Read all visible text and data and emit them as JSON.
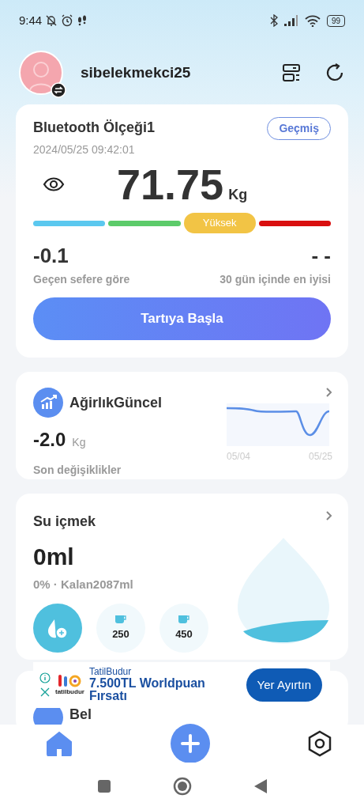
{
  "status_bar": {
    "time": "9:44",
    "battery": "99"
  },
  "profile": {
    "username": "sibelekmekci25"
  },
  "scale_card": {
    "title": "Bluetooth Ölçeği1",
    "history_button": "Geçmiş",
    "timestamp": "2024/05/25 09:42:01",
    "weight": "71.75",
    "unit": "Kg",
    "segments": [
      {
        "color": "#5bc8ef",
        "selected": false
      },
      {
        "color": "#5ccb6a",
        "selected": false
      },
      {
        "color": "#f2c445",
        "selected": true,
        "label": "Yüksek"
      },
      {
        "color": "#d90f0f",
        "selected": false
      }
    ],
    "change_value": "-0.1",
    "change_label": "Geçen sefere göre",
    "best_value": "- -",
    "best_label": "30 gün içinde en iyisi",
    "start_button": "Tartıya Başla"
  },
  "weight_card": {
    "title": "AğirlıkGüncel",
    "value": "-2.0",
    "unit": "Kg",
    "caption": "Son değişiklikler",
    "x_labels": [
      "05/04",
      "05/25"
    ]
  },
  "water_card": {
    "title": "Su içmek",
    "amount": "0ml",
    "summary": "0% · Kalan2087ml",
    "cups": [
      "250",
      "450"
    ]
  },
  "partial_card": {
    "title": "Bel"
  },
  "ad": {
    "advertiser": "TatilBudur",
    "logo_text": "tatilbudur",
    "headline": "7.500TL Worldpuan Fırsatı",
    "cta": "Yer Ayırtın"
  },
  "bottom_nav": [
    {
      "kind": "home",
      "selected": true
    },
    {
      "kind": "add",
      "selected": false
    },
    {
      "kind": "settings",
      "selected": false
    }
  ]
}
